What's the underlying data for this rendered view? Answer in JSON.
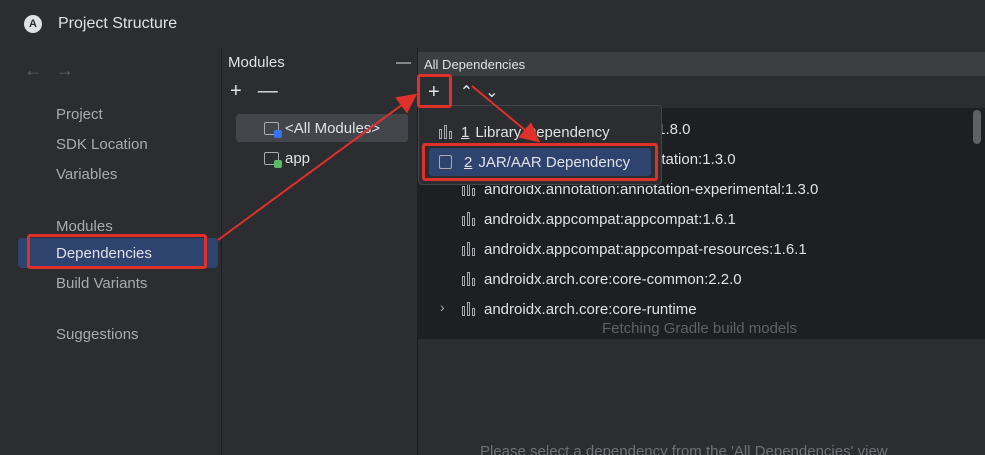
{
  "window": {
    "title": "Project Structure"
  },
  "sidebar": {
    "back": "←",
    "forward": "→",
    "items": [
      "Project",
      "SDK Location",
      "Variables",
      "Modules",
      "Dependencies",
      "Build Variants",
      "Suggestions"
    ],
    "selected": "Dependencies"
  },
  "modules_panel": {
    "title": "Modules",
    "collapse": "—",
    "add": "+",
    "remove": "—",
    "modules": [
      "<All Modules>",
      "app"
    ]
  },
  "deps_panel": {
    "title": "All Dependencies",
    "add": "+",
    "expand": "⌃",
    "collapse": "⌄",
    "dependencies": [
      ":1.8.0",
      "otation:1.3.0",
      "androidx.annotation:annotation-experimental:1.3.0",
      "androidx.appcompat:appcompat:1.6.1",
      "androidx.appcompat:appcompat-resources:1.6.1",
      "androidx.arch.core:core-common:2.2.0",
      "androidx.arch.core:core-runtime"
    ],
    "fetching": "Fetching Gradle build models",
    "details_hint": "Please select a dependency from the 'All Dependencies' view"
  },
  "popup": {
    "items": [
      {
        "num": "1",
        "label": "Library Dependency"
      },
      {
        "num": "2",
        "label": "JAR/AAR Dependency"
      }
    ]
  },
  "colors": {
    "accent": "#2e436e",
    "annotation": "#e0302a"
  }
}
